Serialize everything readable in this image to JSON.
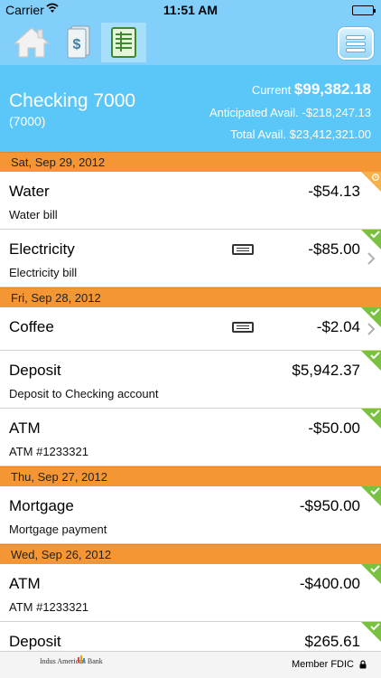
{
  "status_bar": {
    "carrier": "Carrier",
    "time": "11:51 AM"
  },
  "toolbar": {
    "icons": [
      "home-icon",
      "cash-icon",
      "register-icon",
      "menu-icon"
    ],
    "active_tab": "register"
  },
  "account": {
    "name": "Checking 7000",
    "number": "(7000)",
    "current_label": "Current",
    "current_value": "$99,382.18",
    "anticipated_label": "Anticipated Avail.",
    "anticipated_value": "-$218,247.13",
    "total_label": "Total Avail.",
    "total_value": "$23,412,321.00"
  },
  "colors": {
    "header_blue": "#81cffa",
    "account_blue": "#5bc7f8",
    "date_orange": "#f49634",
    "cleared_green": "#7ac142",
    "pending_orange": "#f0a030"
  },
  "groups": [
    {
      "date": "Sat, Sep 29, 2012",
      "transactions": [
        {
          "payee": "Water",
          "memo": "Water bill",
          "amount": "-$54.13",
          "status": "pending",
          "note": false,
          "chevron": false
        },
        {
          "payee": "Electricity",
          "memo": "Electricity bill",
          "amount": "-$85.00",
          "status": "cleared",
          "note": true,
          "chevron": true
        }
      ]
    },
    {
      "date": "Fri, Sep 28, 2012",
      "transactions": [
        {
          "payee": "Coffee",
          "memo": "",
          "amount": "-$2.04",
          "status": "cleared",
          "note": true,
          "chevron": true
        },
        {
          "payee": "Deposit",
          "memo": "Deposit to Checking account",
          "amount": "$5,942.37",
          "status": "cleared",
          "note": false,
          "chevron": false
        },
        {
          "payee": "ATM",
          "memo": "ATM #1233321",
          "amount": "-$50.00",
          "status": "cleared",
          "note": false,
          "chevron": false
        }
      ]
    },
    {
      "date": "Thu, Sep 27, 2012",
      "transactions": [
        {
          "payee": "Mortgage",
          "memo": "Mortgage payment",
          "amount": "-$950.00",
          "status": "cleared",
          "note": false,
          "chevron": false
        }
      ]
    },
    {
      "date": "Wed, Sep 26, 2012",
      "transactions": [
        {
          "payee": "ATM",
          "memo": "ATM #1233321",
          "amount": "-$400.00",
          "status": "cleared",
          "note": false,
          "chevron": false
        },
        {
          "payee": "Deposit",
          "memo": "",
          "amount": "$265.61",
          "status": "cleared",
          "note": false,
          "chevron": false
        }
      ]
    }
  ],
  "footer": {
    "bank_name": "Indus American Bank",
    "member_fdic": "Member FDIC"
  }
}
